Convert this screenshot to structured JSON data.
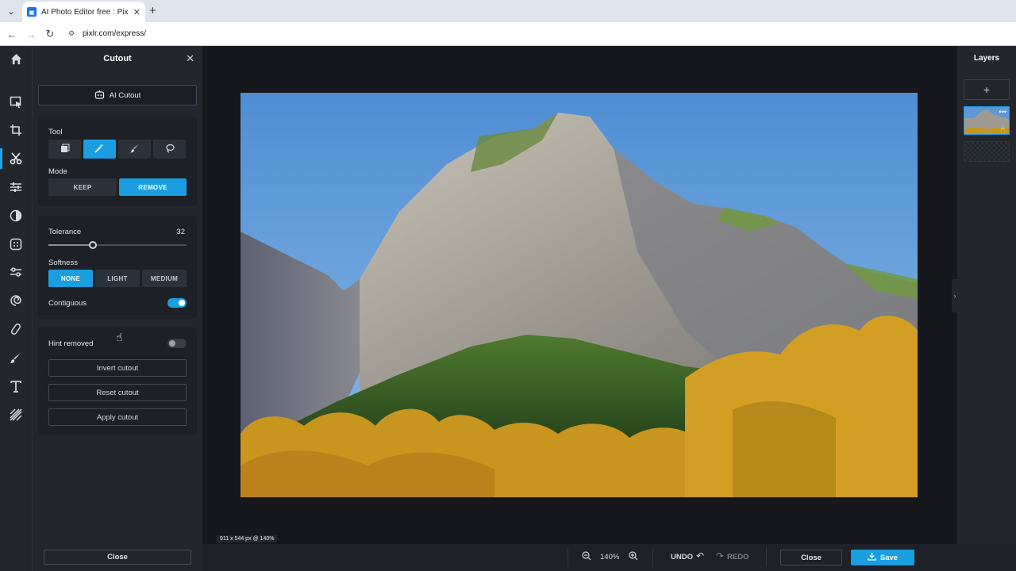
{
  "browser": {
    "tab_title": "AI Photo Editor free : Pixlr Express",
    "url": "pixlr.com/express/"
  },
  "left_toolbar": {
    "icons": [
      "home-icon",
      "arrange-icon",
      "crop-icon",
      "cutout-icon",
      "adjust-icon",
      "filter-icon",
      "effect-icon",
      "liquify-icon",
      "retouch-icon",
      "heal-icon",
      "draw-icon",
      "text-icon",
      "pattern-icon"
    ],
    "active": "cutout-icon"
  },
  "cutout_panel": {
    "title": "Cutout",
    "ai_cutout_label": "AI Cutout",
    "tool_label": "Tool",
    "tools": [
      "shape",
      "magic-wand",
      "brush",
      "lasso"
    ],
    "active_tool": "magic-wand",
    "mode_label": "Mode",
    "mode_keep": "KEEP",
    "mode_remove": "REMOVE",
    "active_mode": "REMOVE",
    "tolerance_label": "Tolerance",
    "tolerance_value": "32",
    "tolerance_fraction": 0.32,
    "softness_label": "Softness",
    "softness_none": "NONE",
    "softness_light": "LIGHT",
    "softness_medium": "MEDIUM",
    "active_softness": "NONE",
    "contiguous_label": "Contiguous",
    "contiguous_on": true,
    "hint_removed_label": "Hint removed",
    "hint_removed_on": false,
    "invert_label": "Invert cutout",
    "reset_label": "Reset cutout",
    "apply_label": "Apply cutout",
    "close_label": "Close"
  },
  "canvas": {
    "dims_text": "911 x 544 px @ 140%"
  },
  "bottom_bar": {
    "zoom_value": "140%",
    "undo_label": "UNDO",
    "redo_label": "REDO",
    "close_label": "Close",
    "save_label": "Save"
  },
  "layers_panel": {
    "title": "Layers",
    "add_label": "+"
  },
  "colors": {
    "accent": "#1a9ee0",
    "panel_bg": "#23262d",
    "canvas_bg": "#16181d"
  }
}
